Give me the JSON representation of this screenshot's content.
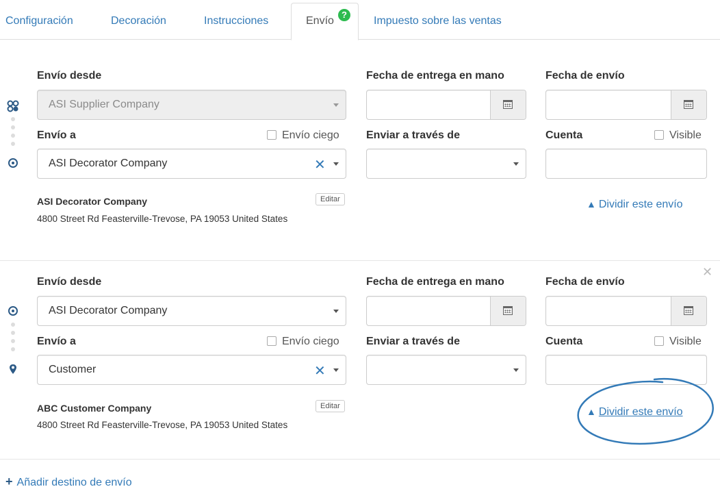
{
  "tabs": [
    {
      "label": "Configuración"
    },
    {
      "label": "Decoración"
    },
    {
      "label": "Instrucciones"
    },
    {
      "label": "Envío",
      "active": true,
      "badge": "?"
    },
    {
      "label": "Impuesto sobre las ventas"
    }
  ],
  "labels": {
    "ship_from": "Envío desde",
    "ship_to": "Envío a",
    "blind_ship": "Envío ciego",
    "in_hands_date": "Fecha de entrega en mano",
    "ship_date": "Fecha de envío",
    "ship_via": "Enviar a través de",
    "account": "Cuenta",
    "visible": "Visible",
    "edit": "Editar",
    "split": "Dividir este envío",
    "add_destination": "Añadir destino de envío"
  },
  "shipments": [
    {
      "ship_from": "ASI Supplier Company",
      "ship_from_disabled": true,
      "ship_to": "ASI Decorator Company",
      "address_company": "ASI Decorator Company",
      "address_line": "4800 Street Rd Feasterville-Trevose, PA 19053 United States",
      "ship_via": "",
      "account": "",
      "in_hands_date": "",
      "ship_date": ""
    },
    {
      "ship_from": "ASI Decorator Company",
      "ship_from_disabled": false,
      "ship_to": "Customer",
      "address_company": "ABC Customer Company",
      "address_line": "4800 Street Rd Feasterville-Trevose, PA 19053 United States",
      "ship_via": "",
      "account": "",
      "in_hands_date": "",
      "ship_date": ""
    }
  ],
  "icons": {
    "calendar": "calendar-icon",
    "split": "sitemap-icon",
    "clear": "close-icon",
    "remove": "close-icon",
    "supplier": "supplier-icon",
    "target": "target-icon",
    "marker": "map-marker-icon",
    "add": "plus-icon"
  },
  "colors": {
    "link": "#337ab7",
    "badge": "#2dbb4f",
    "icon_dark": "#2c5a86",
    "highlight": "#337ab7"
  }
}
